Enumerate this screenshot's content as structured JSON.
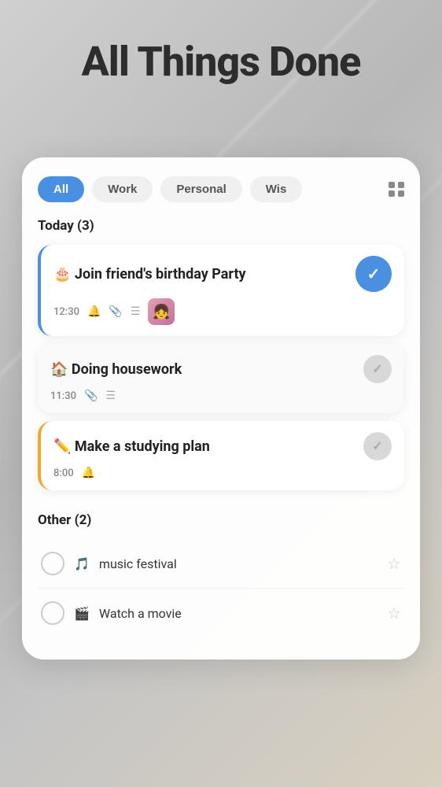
{
  "app": {
    "title": "All Things Done"
  },
  "filters": {
    "tabs": [
      {
        "label": "All",
        "active": true
      },
      {
        "label": "Work",
        "active": false
      },
      {
        "label": "Personal",
        "active": false
      },
      {
        "label": "Wis",
        "active": false
      }
    ]
  },
  "today_section": {
    "heading": "Today (3)",
    "tasks": [
      {
        "id": "birthday",
        "emoji": "🎂",
        "title": "Join friend's birthday Party",
        "time": "12:30",
        "has_bell": true,
        "has_attachment": true,
        "has_list": true,
        "has_thumbnail": true,
        "completed": true,
        "check_color": "blue"
      },
      {
        "id": "housework",
        "emoji": "🏠",
        "title": "Doing housework",
        "time": "11:30",
        "has_bell": false,
        "has_attachment": true,
        "has_list": true,
        "has_thumbnail": false,
        "completed": false,
        "check_color": "gray"
      },
      {
        "id": "study",
        "emoji": "✏️",
        "title": "Make a studying plan",
        "time": "8:00",
        "has_bell": true,
        "has_attachment": false,
        "has_list": false,
        "has_thumbnail": false,
        "completed": false,
        "check_color": "gray"
      }
    ]
  },
  "other_section": {
    "heading": "Other (2)",
    "items": [
      {
        "id": "music",
        "emoji": "🎵",
        "label": "music festival",
        "starred": false
      },
      {
        "id": "movie",
        "emoji": "🎬",
        "label": "Watch a movie",
        "starred": false
      }
    ]
  }
}
